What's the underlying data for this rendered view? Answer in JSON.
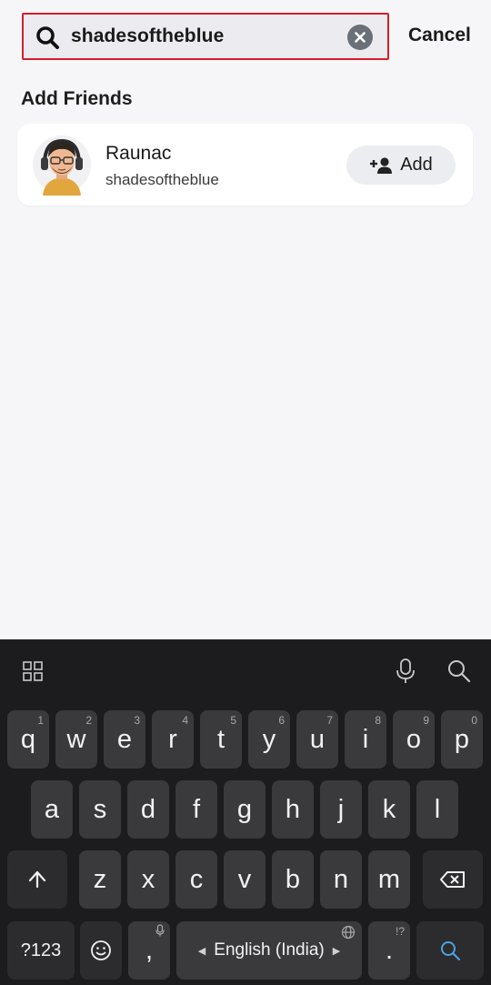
{
  "search": {
    "value": "shadesoftheblue",
    "cancel_label": "Cancel"
  },
  "section": {
    "title": "Add Friends"
  },
  "friend": {
    "name": "Raunac",
    "username": "shadesoftheblue",
    "add_label": "Add"
  },
  "keyboard": {
    "row1": [
      {
        "label": "q",
        "hint": "1"
      },
      {
        "label": "w",
        "hint": "2"
      },
      {
        "label": "e",
        "hint": "3"
      },
      {
        "label": "r",
        "hint": "4"
      },
      {
        "label": "t",
        "hint": "5"
      },
      {
        "label": "y",
        "hint": "6"
      },
      {
        "label": "u",
        "hint": "7"
      },
      {
        "label": "i",
        "hint": "8"
      },
      {
        "label": "o",
        "hint": "9"
      },
      {
        "label": "p",
        "hint": "0"
      }
    ],
    "row2": [
      "a",
      "s",
      "d",
      "f",
      "g",
      "h",
      "j",
      "k",
      "l"
    ],
    "row3": [
      "z",
      "x",
      "c",
      "v",
      "b",
      "n",
      "m"
    ],
    "symbols_label": "?123",
    "comma_label": ",",
    "space_label": "English (India)",
    "period_label": ".",
    "period_hint": "!?"
  },
  "colors": {
    "highlight": "#d21f2b",
    "keyboard_bg": "#1c1c1e",
    "key_bg": "#3a3a3d",
    "search_key_icon": "#4aa3df"
  },
  "icons": {
    "search": "search-icon",
    "clear": "clear-icon",
    "add_friend": "add-friend-icon",
    "grid": "grid-icon",
    "mic": "microphone-icon",
    "kb_search": "search-icon",
    "shift": "shift-arrow-icon",
    "backspace": "backspace-icon",
    "emoji": "emoji-icon",
    "globe": "globe-icon"
  }
}
